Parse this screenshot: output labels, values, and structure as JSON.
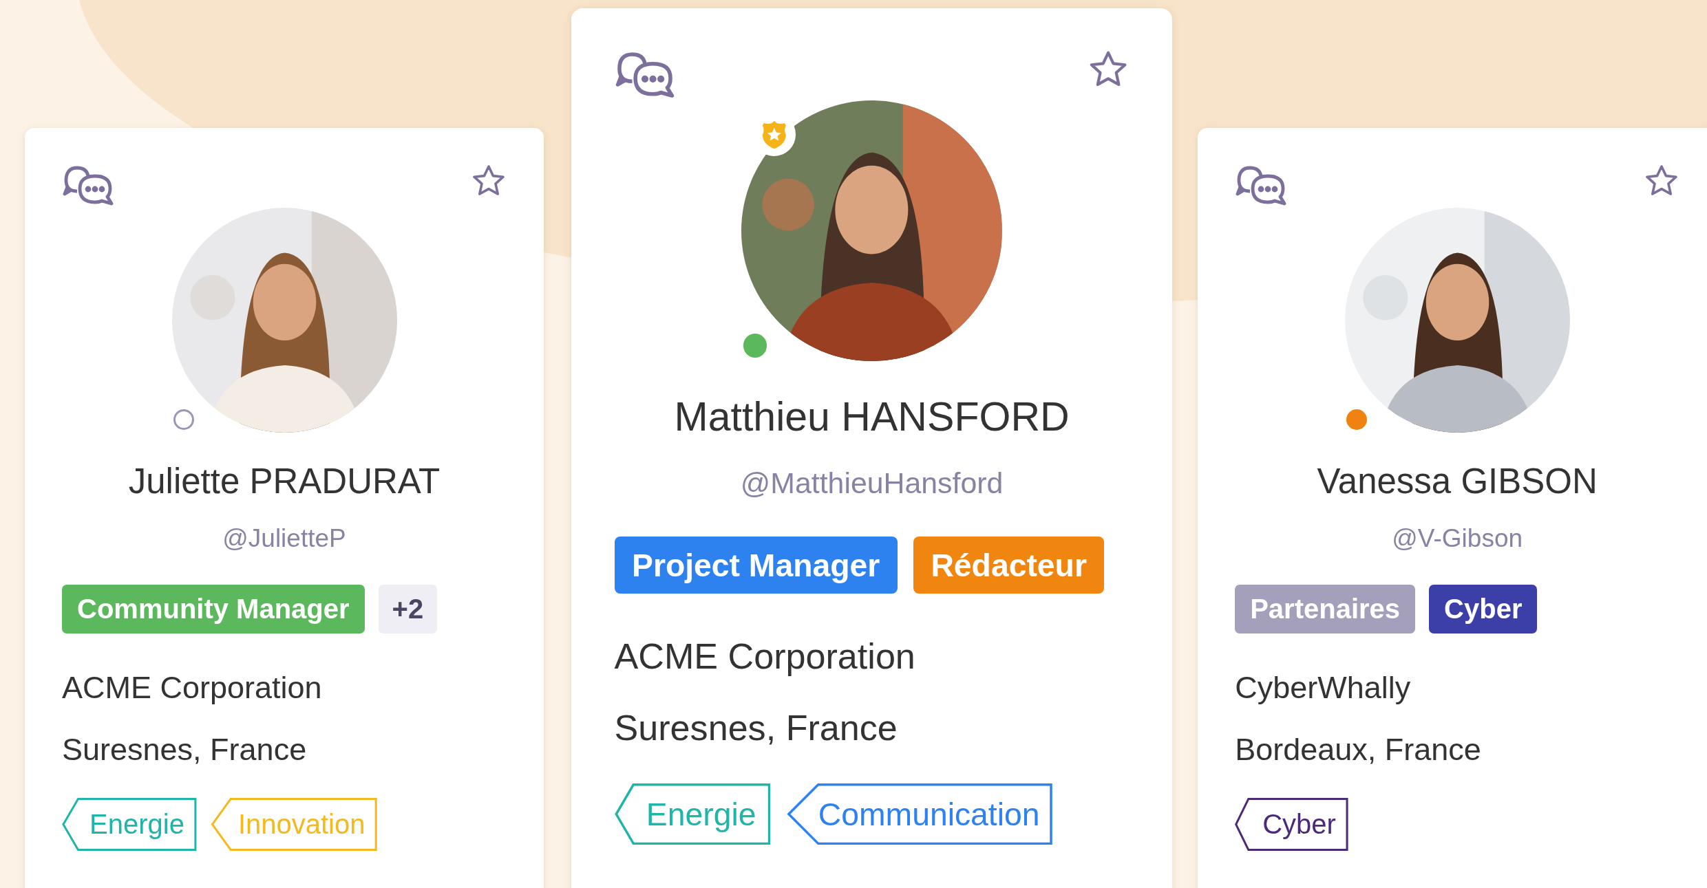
{
  "cards": [
    {
      "name": "Juliette PRADURAT",
      "handle": "@JulietteP",
      "status": {
        "kind": "outline",
        "color": "#9e94b4"
      },
      "badge": false,
      "photo": {
        "kind": "picture"
      },
      "roles": [
        {
          "label": "Community Manager",
          "color": "#5cb85c"
        }
      ],
      "more": "+2",
      "company": "ACME Corporation",
      "location": "Suresnes, France",
      "topics": [
        {
          "label": "Energie",
          "color": "#1fb5a8"
        },
        {
          "label": "Innovation",
          "color": "#f5b920"
        }
      ]
    },
    {
      "name": "Matthieu HANSFORD",
      "handle": "@MatthieuHansford",
      "status": {
        "kind": "filled",
        "color": "#5cb85c"
      },
      "badge": true,
      "photo": {
        "kind": "picture"
      },
      "roles": [
        {
          "label": "Project Manager",
          "color": "#2d82f0"
        },
        {
          "label": "Rédacteur",
          "color": "#f0850f"
        }
      ],
      "company": "ACME Corporation",
      "location": "Suresnes, France",
      "topics": [
        {
          "label": "Energie",
          "color": "#1fb5a8"
        },
        {
          "label": "Communication",
          "color": "#2d82f0"
        }
      ]
    },
    {
      "name": "Vanessa GIBSON",
      "handle": "@V-Gibson",
      "status": {
        "kind": "filled",
        "color": "#f0830f"
      },
      "badge": false,
      "photo": {
        "kind": "picture"
      },
      "roles": [
        {
          "label": "Partenaires",
          "color": "#a49fba"
        },
        {
          "label": "Cyber",
          "color": "#3d3fa8"
        }
      ],
      "company": "CyberWhally",
      "location": "Bordeaux, France",
      "topics": [
        {
          "label": "Cyber",
          "color": "#4b2a7a"
        }
      ]
    }
  ]
}
